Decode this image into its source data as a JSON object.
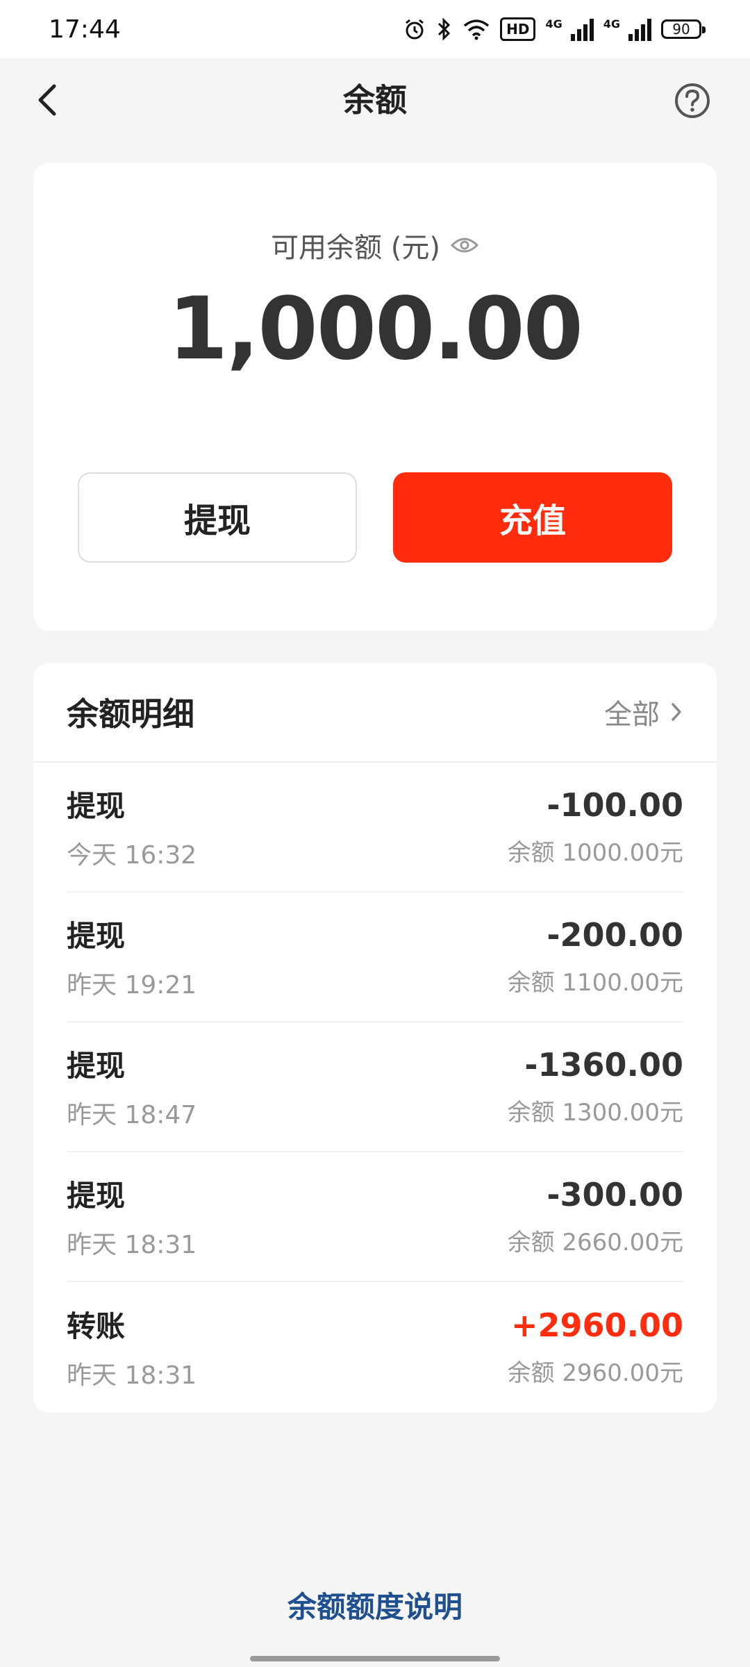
{
  "status_bar": {
    "time": "17:44",
    "hd_label": "HD",
    "net1": "4G",
    "net2": "4G",
    "battery": "90",
    "icons": [
      "alarm-icon",
      "bluetooth-icon",
      "wifi-icon"
    ]
  },
  "nav": {
    "title": "余额",
    "back_icon": "chevron-left-icon",
    "help_icon": "help-circle-icon"
  },
  "balance": {
    "label": "可用余额 (元)",
    "amount": "1,000.00",
    "withdraw_label": "提现",
    "recharge_label": "充值",
    "eye_icon": "eye-icon"
  },
  "details": {
    "title": "余额明细",
    "all_label": "全部",
    "items": [
      {
        "type": "提现",
        "time": "今天 16:32",
        "amount": "-100.00",
        "balance": "余额 1000.00元",
        "positive": false
      },
      {
        "type": "提现",
        "time": "昨天 19:21",
        "amount": "-200.00",
        "balance": "余额 1100.00元",
        "positive": false
      },
      {
        "type": "提现",
        "time": "昨天 18:47",
        "amount": "-1360.00",
        "balance": "余额 1300.00元",
        "positive": false
      },
      {
        "type": "提现",
        "time": "昨天 18:31",
        "amount": "-300.00",
        "balance": "余额 2660.00元",
        "positive": false
      },
      {
        "type": "转账",
        "time": "昨天 18:31",
        "amount": "+2960.00",
        "balance": "余额 2960.00元",
        "positive": true
      }
    ]
  },
  "footer": {
    "link_label": "余额额度说明"
  },
  "colors": {
    "accent": "#ff2c0d",
    "link": "#1f4f8f"
  }
}
